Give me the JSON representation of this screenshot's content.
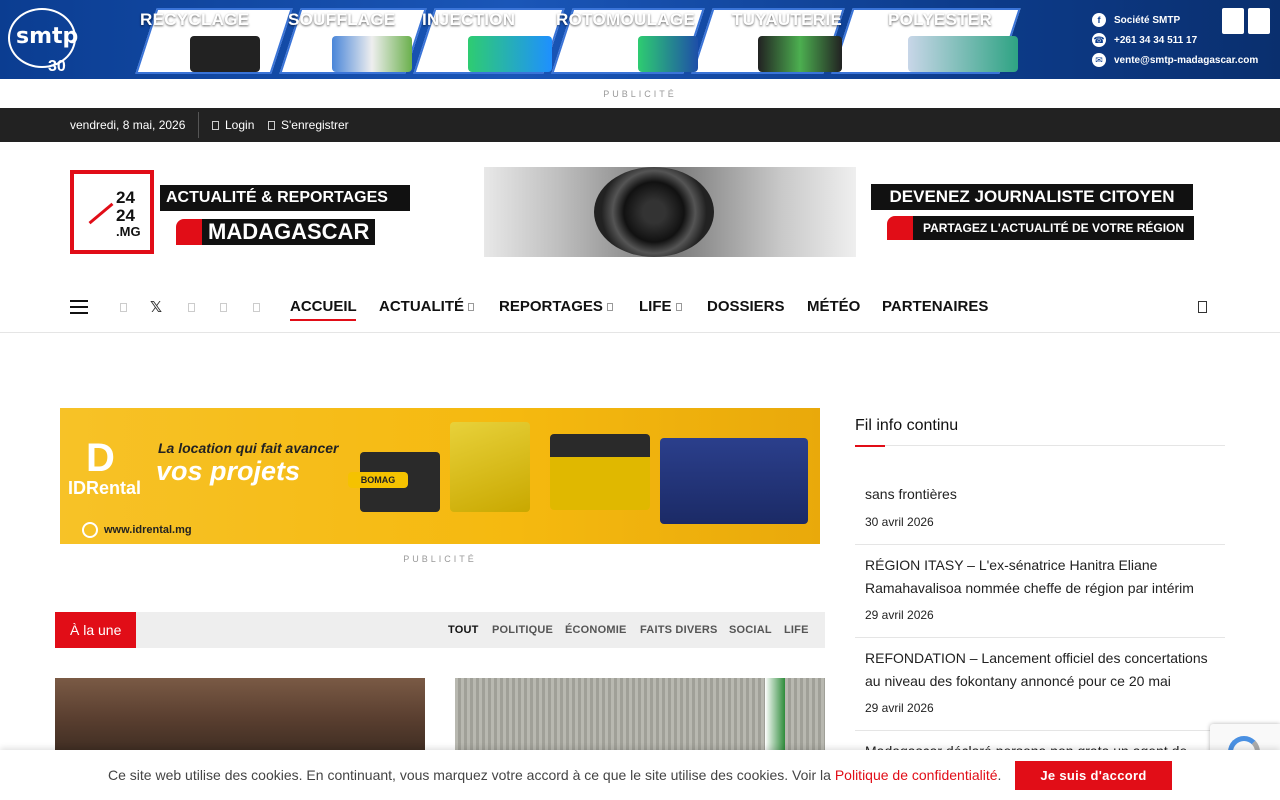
{
  "top_banner": {
    "brand": "smtp",
    "anniversary": "30",
    "tiles": [
      "RECYCLAGE",
      "SOUFFLAGE",
      "INJECTION",
      "ROTOMOULAGE",
      "TUYAUTERIE",
      "POLYESTER"
    ],
    "contact": {
      "facebook": "Société SMTP",
      "phone": "+261 34 34 511 17",
      "email": "vente@smtp-madagascar.com"
    },
    "colors": {
      "bg": "#0b3d91"
    }
  },
  "publicite_label": "PUBLICITÉ",
  "top_bar": {
    "date": "vendredi, 8 mai, 2026",
    "login": "Login",
    "register": "S'enregistrer"
  },
  "logo": {
    "n1": "24",
    "n2": "24",
    "mg": ".MG",
    "line1": "ACTUALITÉ & REPORTAGES",
    "line2": "MADAGASCAR"
  },
  "header_ad": {
    "line1": "DEVENEZ JOURNALISTE CITOYEN",
    "line2": "PARTAGEZ L'ACTUALITÉ DE VOTRE RÉGION"
  },
  "nav": {
    "social_icons": [
      "facebook-icon",
      "x-icon",
      "instagram-icon",
      "youtube-icon",
      "tiktok-icon"
    ],
    "x_glyph": "𝕏",
    "items": [
      {
        "label": "ACCUEIL",
        "has_caret": false
      },
      {
        "label": "ACTUALITÉ",
        "has_caret": true
      },
      {
        "label": "REPORTAGES",
        "has_caret": true
      },
      {
        "label": "LIFE",
        "has_caret": true
      },
      {
        "label": "DOSSIERS",
        "has_caret": false
      },
      {
        "label": "MÉTÉO",
        "has_caret": false
      },
      {
        "label": "PARTENAIRES",
        "has_caret": false
      }
    ],
    "active": "ACCUEIL"
  },
  "idrental_ad": {
    "brand": "IDRental",
    "tagline1": "La location qui fait avancer",
    "tagline2": "vos projets",
    "url": "www.idrental.mg",
    "machine_label": "BOMAG"
  },
  "une": {
    "label": "À la une",
    "filters": [
      "TOUT",
      "POLITIQUE",
      "ÉCONOMIE",
      "FAITS DIVERS",
      "SOCIAL",
      "LIFE"
    ],
    "active_filter": "TOUT"
  },
  "sidebar": {
    "title": "Fil info continu",
    "items": [
      {
        "title": "sans frontières",
        "date": "30 avril 2026"
      },
      {
        "title": "RÉGION ITASY – L'ex-sénatrice Hanitra Eliane Ramahavalisoa nommée cheffe de région par intérim",
        "date": "29 avril 2026"
      },
      {
        "title": "REFONDATION – Lancement officiel des concertations au niveau des fokontany annoncé pour ce 20 mai",
        "date": "29 avril 2026"
      },
      {
        "title": "Madagascar déclaré persona non grata un agent de",
        "date": ""
      }
    ]
  },
  "cookie": {
    "text": "Ce site web utilise des cookies. En continuant, vous marquez votre accord à ce que le site utilise des cookies. Voir la ",
    "link": "Politique de confidentialité",
    "end": ".",
    "button": "Je suis d'accord"
  },
  "colors": {
    "accent": "#e10d17",
    "topbar": "#222222"
  }
}
